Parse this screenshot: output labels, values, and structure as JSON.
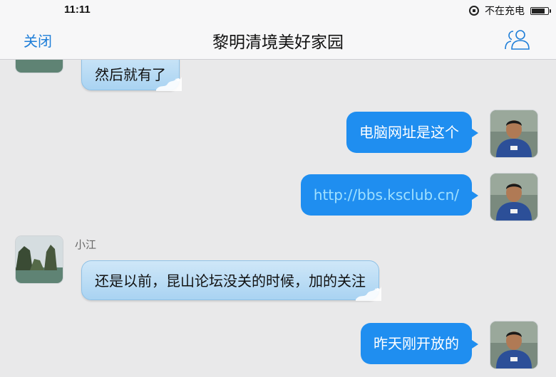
{
  "status_bar": {
    "time": "11:11",
    "charging_text": "不在充电"
  },
  "nav": {
    "close_label": "关闭",
    "title": "黎明清境美好家园"
  },
  "messages": [
    {
      "direction": "in",
      "text": "然后就有了"
    },
    {
      "direction": "out",
      "text": "电脑网址是这个"
    },
    {
      "direction": "out",
      "text": "http://bbs.ksclub.cn/"
    },
    {
      "direction": "in",
      "sender": "小江",
      "text": "还是以前，昆山论坛没关的时候，加的关注"
    },
    {
      "direction": "out",
      "text": "昨天刚开放的"
    }
  ],
  "colors": {
    "accent": "#1e7ed8",
    "outgoing_bubble": "#1f8ef0",
    "incoming_bubble": "#b9dcf5"
  }
}
